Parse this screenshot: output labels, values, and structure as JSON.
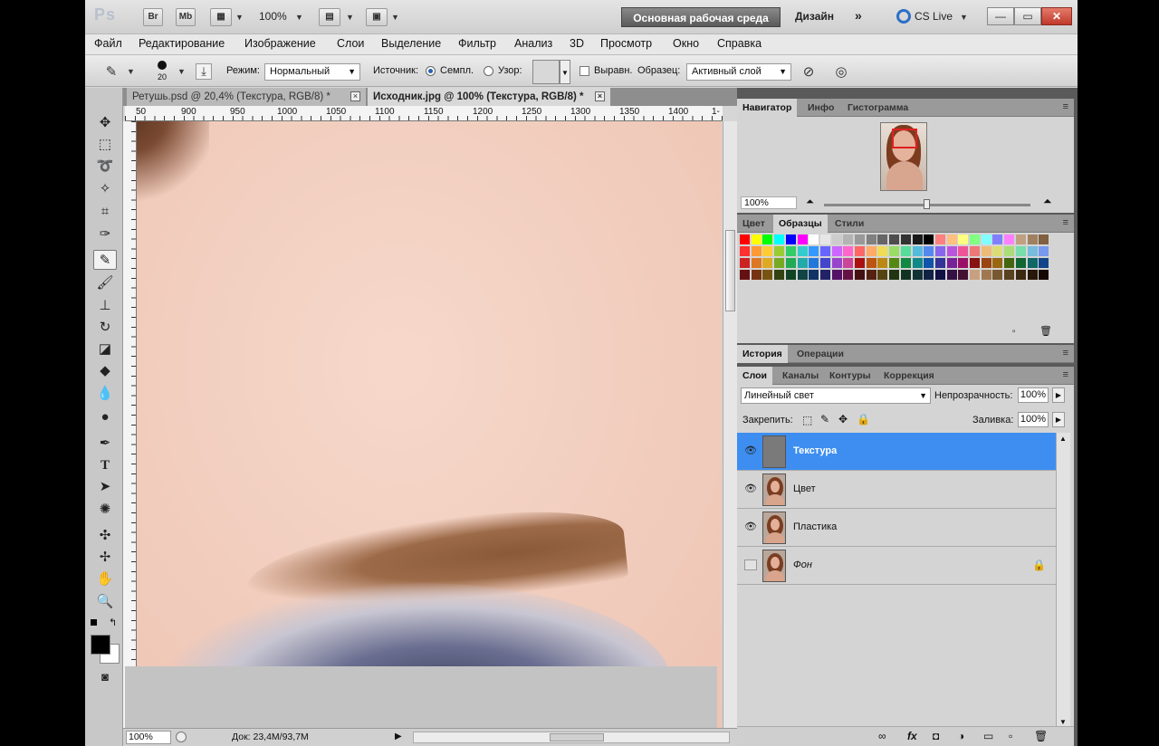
{
  "app": {
    "logo": "Ps",
    "bar_buttons": [
      "Br",
      "Mb"
    ],
    "zoom_level": "100%",
    "workspace": "Основная рабочая среда",
    "design": "Дизайн",
    "more": "»",
    "cslive": "CS Live",
    "window_controls": {
      "minimize": "—",
      "restore": "▭",
      "close": "✕"
    }
  },
  "menu": [
    "Файл",
    "Редактирование",
    "Изображение",
    "Слои",
    "Выделение",
    "Фильтр",
    "Анализ",
    "3D",
    "Просмотр",
    "Окно",
    "Справка"
  ],
  "options": {
    "brush_size": "20",
    "mode_label": "Режим:",
    "mode_value": "Нормальный",
    "source_label": "Источник:",
    "sample_label": "Семпл.",
    "pattern_label": "Узор:",
    "aligned_label": "Выравн.",
    "sample_from_label": "Образец:",
    "sample_from_value": "Активный слой"
  },
  "tabs": [
    {
      "label": "Ретушь.psd @ 20,4% (Текстура, RGB/8) *",
      "close": "×",
      "active": false
    },
    {
      "label": "Исходник.jpg @ 100% (Текстура, RGB/8) *",
      "close": "×",
      "active": true
    }
  ],
  "rulers": {
    "h": [
      "50",
      "900",
      "950",
      "1000",
      "1050",
      "1100",
      "1150",
      "1200",
      "1250",
      "1300",
      "1350",
      "1400",
      "1-"
    ]
  },
  "status": {
    "zoom": "100%",
    "doc": "Док: 23,4M/93,7M"
  },
  "navigator": {
    "tabs": [
      "Навигатор",
      "Инфо",
      "Гистограмма"
    ],
    "zoom": "100%"
  },
  "swatches_panel": {
    "tabs": [
      "Цвет",
      "Образцы",
      "Стили"
    ],
    "colors": [
      [
        "#ff0000",
        "#ffff00",
        "#00ff00",
        "#00ffff",
        "#0000ff",
        "#ff00ff",
        "#ffffff",
        "#e6e6e6",
        "#cccccc",
        "#b3b3b3",
        "#999999",
        "#808080",
        "#666666",
        "#4d4d4d",
        "#333333",
        "#1a1a1a",
        "#000000",
        "#ff8080",
        "#ffc080",
        "#ffff80",
        "#80ff80",
        "#80ffff",
        "#8080ff",
        "#ff80ff",
        "#c0a080",
        "#a08060",
        "#806040"
      ],
      [
        "#ff3030",
        "#ff9933",
        "#ffcc33",
        "#99cc33",
        "#33cc66",
        "#33cccc",
        "#3399ff",
        "#6666ff",
        "#cc66ff",
        "#ff66cc",
        "#ff6666",
        "#ffaa66",
        "#eedd55",
        "#99dd66",
        "#55dd99",
        "#55bbdd",
        "#5588ee",
        "#8866ee",
        "#bb55dd",
        "#ee5599",
        "#ee7777",
        "#eebb77",
        "#dddd77",
        "#aadd77",
        "#77ddaa",
        "#77bbdd",
        "#7799ee"
      ],
      [
        "#cc2222",
        "#dd7722",
        "#ddaa22",
        "#77aa22",
        "#22aa55",
        "#22aaaa",
        "#2277dd",
        "#4444cc",
        "#9944cc",
        "#cc4499",
        "#aa1111",
        "#bb5511",
        "#bb8811",
        "#558811",
        "#118844",
        "#118888",
        "#1155aa",
        "#333399",
        "#772299",
        "#991166",
        "#881111",
        "#994411",
        "#996611",
        "#446611",
        "#116633",
        "#116666",
        "#114488"
      ],
      [
        "#661111",
        "#773311",
        "#775511",
        "#334411",
        "#114422",
        "#114444",
        "#113366",
        "#222266",
        "#551166",
        "#661144",
        "#441111",
        "#552211",
        "#554411",
        "#223311",
        "#113322",
        "#113333",
        "#112244",
        "#111144",
        "#331144",
        "#441133",
        "#c8a080",
        "#a07850",
        "#785830",
        "#584020",
        "#3c2810",
        "#281808",
        "#140800"
      ]
    ]
  },
  "history_tabs": [
    "История",
    "Операции"
  ],
  "layers": {
    "tabs": [
      "Слои",
      "Каналы",
      "Контуры",
      "Коррекция"
    ],
    "blend": "Линейный свет",
    "opacity_label": "Непрозрачность:",
    "opacity": "100%",
    "lock_label": "Закрепить:",
    "fill_label": "Заливка:",
    "fill": "100%",
    "items": [
      {
        "name": "Текстура",
        "visible": true,
        "selected": true,
        "thumb": "gray"
      },
      {
        "name": "Цвет",
        "visible": true,
        "selected": false,
        "thumb": "photo"
      },
      {
        "name": "Пластика",
        "visible": true,
        "selected": false,
        "thumb": "photo"
      },
      {
        "name": "Фон",
        "visible": false,
        "selected": false,
        "thumb": "photo",
        "locked": true
      }
    ],
    "footer_icons": [
      "link-icon",
      "fx-icon",
      "mask-icon",
      "adjustment-icon",
      "folder-icon",
      "new-layer-icon",
      "trash-icon"
    ]
  }
}
